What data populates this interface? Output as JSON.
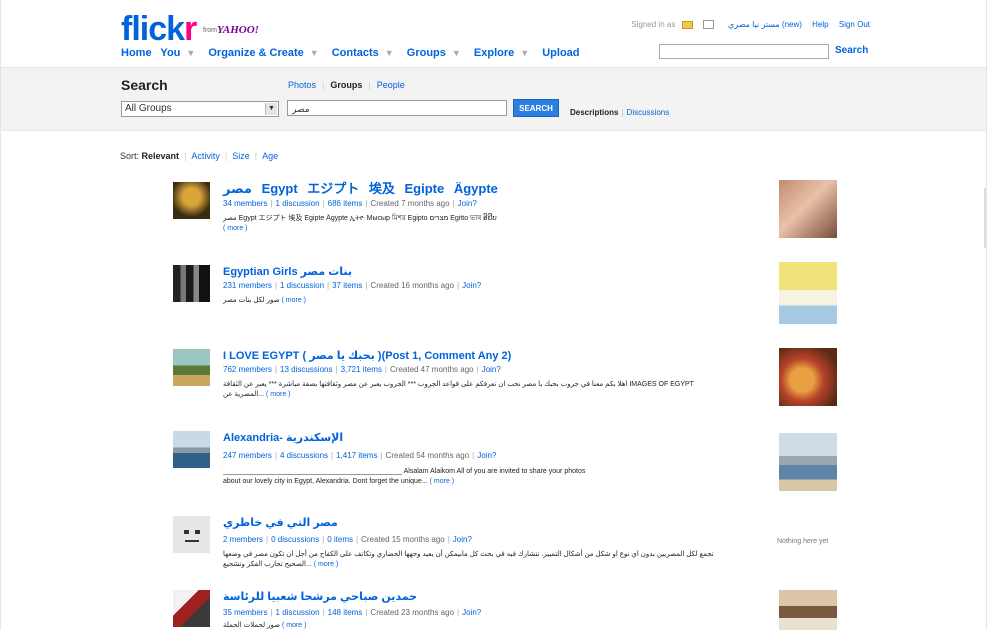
{
  "header": {
    "logo_main": "flick",
    "logo_r": "r",
    "logo_from": "from",
    "logo_yahoo": "YAHOO!",
    "signed_in": "Signed in as",
    "account_name": "مستر نيا مصري (new)",
    "help": "Help",
    "sign_out": "Sign Out",
    "nav": [
      {
        "label": "Home",
        "menu": false
      },
      {
        "label": "You",
        "menu": true
      },
      {
        "label": "Organize & Create",
        "menu": true
      },
      {
        "label": "Contacts",
        "menu": true
      },
      {
        "label": "Groups",
        "menu": true
      },
      {
        "label": "Explore",
        "menu": true
      },
      {
        "label": "Upload",
        "menu": false
      }
    ],
    "search_button": "Search",
    "search_value": ""
  },
  "search": {
    "title": "Search",
    "tabs": [
      "Photos",
      "Groups",
      "People"
    ],
    "active_tab": "Groups",
    "scope": "All Groups",
    "query": "مصر",
    "button": "SEARCH",
    "filter_active": "Descriptions",
    "filter_other": "Discussions"
  },
  "sort": {
    "label": "Sort:",
    "options": [
      "Relevant",
      "Activity",
      "Size",
      "Age"
    ],
    "active": "Relevant"
  },
  "results": [
    {
      "title": "مصر  Egypt  エジプト  埃及  Egipte  Ägypte",
      "members": "34 members",
      "discussions": "1 discussion",
      "items": "686 items",
      "created": "Created 7 months ago",
      "join": "Join?",
      "description": "مصر  Egypt  エジプト  埃及  Egipte  Ägypte  ኢትዮ  Мысыр  মিশর  Egipto  מצרים  Egitto  ভাৰ  ອີຢິບ",
      "more": "( more )",
      "side": "photo"
    },
    {
      "title": "Egyptian Girls بنات مصر",
      "members": "231 members",
      "discussions": "1 discussion",
      "items": "37 items",
      "created": "Created 16 months ago",
      "join": "Join?",
      "description": "صور لكل بنات مصر",
      "more": "( more )",
      "side": "photo"
    },
    {
      "title": "I LOVE EGYPT ( بحبك يا مصر )(Post 1, Comment Any 2)",
      "members": "762 members",
      "discussions": "13 discussions",
      "items": "3,721 items",
      "created": "Created 47 months ago",
      "join": "Join?",
      "description": "اهلا بكم معنا في جروب بحبك يا مصر نحب ان نعرفكم على قواعد الجروب *** الجروب يعبر عن مصر وثقافتها بصفة مباشرة *** يعبر عن الثقافة IMAGES OF EGYPT",
      "description2": "المصرية عن...",
      "more": "( more )",
      "side": "photo"
    },
    {
      "title": "Alexandria- الإسكندرية",
      "members": "247 members",
      "discussions": "4 discussions",
      "items": "1,417 items",
      "created": "Created 54 months ago",
      "join": "Join?",
      "description": "______________________________________________ Alsalam Alaikom All of you are invited to share your photos",
      "description2": "about our lovely city in Egypt, Alexandria. Dont forget the unique...",
      "more": "( more )",
      "side": "photo"
    },
    {
      "title": "مصر التي في خاطري",
      "members": "2 members",
      "discussions": "0 discussions",
      "items": "0 items",
      "created": "Created 15 months ago",
      "join": "Join?",
      "description": "تجمع لكل المصريين بدون اي نوع او شكل من أشكال التمييز. نتشارك فيه في بحث كل مابيمكن أن يعيد وجهها الحضاري وتكاتف على الكفاح من أجل ان تكون مصر في وضعها",
      "description2": "الصحيح تجارب الفكر وتشجيع...",
      "more": "( more )",
      "side": "Nothing here yet"
    },
    {
      "title": "حمدين صباحي مرشحا شعبيا للرئاسة",
      "members": "35 members",
      "discussions": "1 discussion",
      "items": "148 items",
      "created": "Created 23 months ago",
      "join": "Join?",
      "description": "صور لحملات الحملة",
      "more": "( more )",
      "side": "photo"
    }
  ],
  "colors": {
    "link": "#0063dc",
    "logo_pink": "#ff0084",
    "band": "#f3f3f3",
    "button": "#2a7fe0"
  }
}
